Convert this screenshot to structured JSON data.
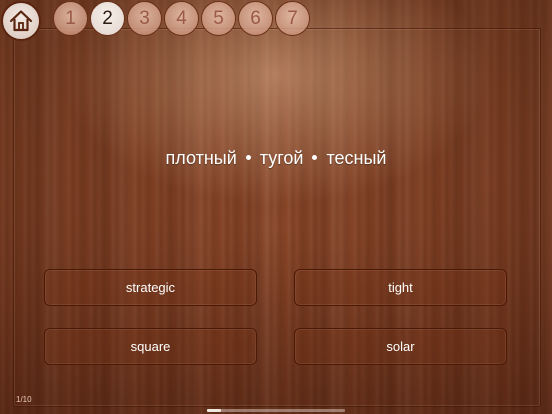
{
  "home": {
    "icon": "home-icon"
  },
  "levels": [
    "1",
    "2",
    "3",
    "4",
    "5",
    "6",
    "7"
  ],
  "active_level": "2",
  "prompt": {
    "words": [
      "плотный",
      "тугой",
      "тесный"
    ]
  },
  "answers": [
    "strategic",
    "tight",
    "square",
    "solar"
  ],
  "progress": {
    "label": "1/10",
    "current": 1,
    "total": 10
  },
  "colors": {
    "wood": "#8a4526",
    "frame": "#4a1a08",
    "text": "#ffffff"
  }
}
